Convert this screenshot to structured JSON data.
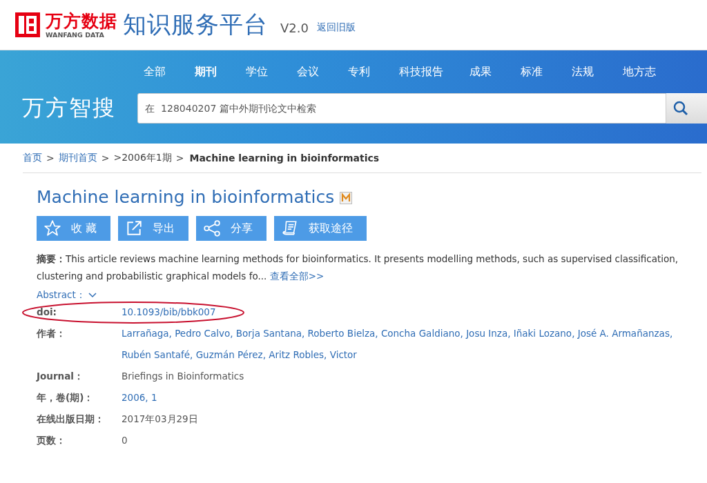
{
  "header": {
    "logo_cn": "万方数据",
    "logo_en": "WANFANG DATA",
    "platform": "知识服务平台",
    "version": "V2.0",
    "old_version_link": "返回旧版"
  },
  "banner": {
    "brand": "万方智搜",
    "nav": [
      {
        "label": "全部",
        "selected": false
      },
      {
        "label": "期刊",
        "selected": true
      },
      {
        "label": "学位",
        "selected": false
      },
      {
        "label": "会议",
        "selected": false
      },
      {
        "label": "专利",
        "selected": false
      },
      {
        "label": "科技报告",
        "selected": false
      },
      {
        "label": "成果",
        "selected": false
      },
      {
        "label": "标准",
        "selected": false
      },
      {
        "label": "法规",
        "selected": false
      },
      {
        "label": "地方志",
        "selected": false
      }
    ],
    "search": {
      "placeholder": "在  128040207 篇中外期刊论文中检索"
    }
  },
  "breadcrumb": [
    {
      "label": "首页",
      "kind": "link"
    },
    {
      "label": ">",
      "kind": "sep"
    },
    {
      "label": "期刊首页",
      "kind": "link"
    },
    {
      "label": ">",
      "kind": "sep"
    },
    {
      "label": ">2006年1期",
      "kind": "text"
    },
    {
      "label": ">",
      "kind": "sep"
    },
    {
      "label": "Machine learning in bioinformatics",
      "kind": "current"
    }
  ],
  "article": {
    "title": "Machine learning in bioinformatics",
    "actions": [
      {
        "label": "收 藏",
        "kind": "star"
      },
      {
        "label": "导出",
        "kind": "export"
      },
      {
        "label": "分享",
        "kind": "share"
      },
      {
        "label": "获取途径",
        "kind": "document"
      }
    ],
    "abstract_label": "摘要：",
    "abstract": "This article reviews machine learning methods for bioinformatics. It presents modelling methods, such as supervised classification, clustering and probabilistic graphical models fo...",
    "abstract_more": "查看全部>>",
    "abstract_toggle": "Abstract：",
    "fields": [
      {
        "label": "doi:",
        "value": "10.1093/bib/bbk007",
        "kind": "link",
        "circled": true
      },
      {
        "label": "作者：",
        "value": "Larrañaga, Pedro Calvo, Borja Santana, Roberto Bielza, Concha Galdiano, Josu Inza, Iñaki Lozano, José A. Armañanzas, Rubén Santafé, Guzmán Pérez, Aritz Robles, Victor",
        "kind": "link",
        "circled": false
      },
      {
        "label": "Journal：",
        "value": "Briefings in Bioinformatics",
        "kind": "text",
        "circled": false
      },
      {
        "label": "年，卷(期)：",
        "value": "2006, 1",
        "kind": "link",
        "circled": false
      },
      {
        "label": "在线出版日期：",
        "value": "2017年03月29日",
        "kind": "text",
        "circled": false
      },
      {
        "label": "页数：",
        "value": "0",
        "kind": "text",
        "circled": false
      }
    ]
  }
}
